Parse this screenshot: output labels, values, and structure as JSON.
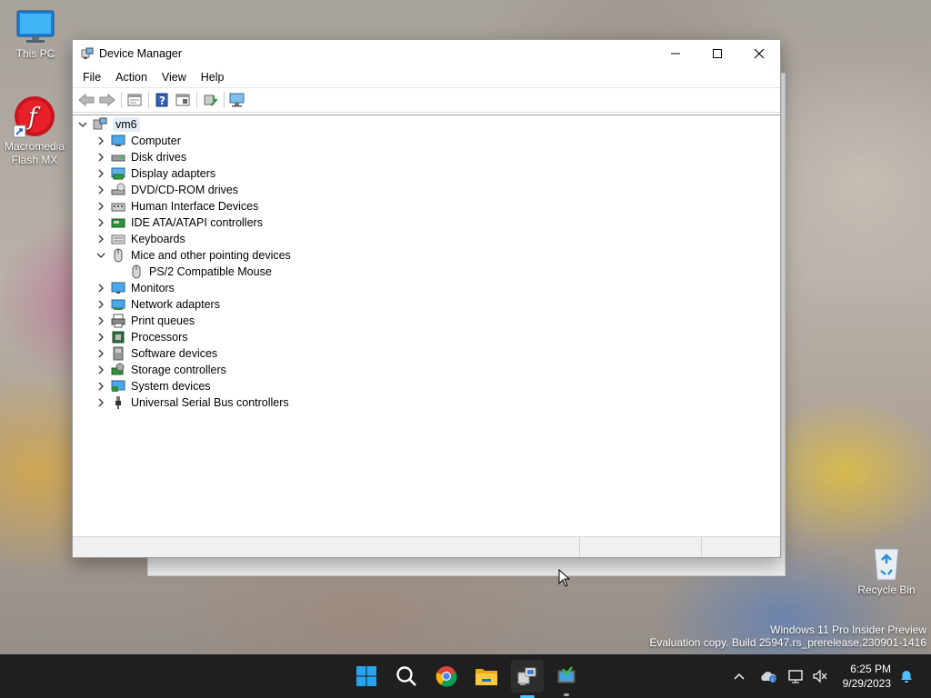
{
  "desktop": {
    "icons": [
      {
        "label": "This PC",
        "icon": "monitor-icon"
      },
      {
        "label": "Macromedia Flash MX",
        "icon": "flash-icon"
      },
      {
        "label": "Recycle Bin",
        "icon": "recycle-bin-icon"
      }
    ],
    "watermark": {
      "line1": "Windows 11 Pro Insider Preview",
      "line2": "Evaluation copy. Build 25947.rs_prerelease.230901-1416"
    }
  },
  "window": {
    "title": "Device Manager",
    "controls": {
      "minimize": "—",
      "maximize": "☐",
      "close": "✕"
    },
    "menu": [
      "File",
      "Action",
      "View",
      "Help"
    ],
    "toolbar": [
      "back",
      "forward",
      "properties",
      "help",
      "view",
      "update-driver",
      "scan-hardware"
    ],
    "tree": {
      "root": "vm6",
      "categories": [
        {
          "label": "Computer",
          "expanded": false,
          "icon": "computer-icon"
        },
        {
          "label": "Disk drives",
          "expanded": false,
          "icon": "disk-drive-icon"
        },
        {
          "label": "Display adapters",
          "expanded": false,
          "icon": "display-adapter-icon"
        },
        {
          "label": "DVD/CD-ROM drives",
          "expanded": false,
          "icon": "dvd-drive-icon"
        },
        {
          "label": "Human Interface Devices",
          "expanded": false,
          "icon": "hid-icon"
        },
        {
          "label": "IDE ATA/ATAPI controllers",
          "expanded": false,
          "icon": "ide-controller-icon"
        },
        {
          "label": "Keyboards",
          "expanded": false,
          "icon": "keyboard-icon"
        },
        {
          "label": "Mice and other pointing devices",
          "expanded": true,
          "icon": "mouse-icon",
          "children": [
            "PS/2 Compatible Mouse"
          ]
        },
        {
          "label": "Monitors",
          "expanded": false,
          "icon": "monitor-icon"
        },
        {
          "label": "Network adapters",
          "expanded": false,
          "icon": "network-adapter-icon"
        },
        {
          "label": "Print queues",
          "expanded": false,
          "icon": "printer-icon"
        },
        {
          "label": "Processors",
          "expanded": false,
          "icon": "processor-icon"
        },
        {
          "label": "Software devices",
          "expanded": false,
          "icon": "software-device-icon"
        },
        {
          "label": "Storage controllers",
          "expanded": false,
          "icon": "storage-controller-icon"
        },
        {
          "label": "System devices",
          "expanded": false,
          "icon": "system-devices-icon"
        },
        {
          "label": "Universal Serial Bus controllers",
          "expanded": false,
          "icon": "usb-icon"
        }
      ]
    }
  },
  "taskbar": {
    "apps": [
      "start-icon",
      "search-icon",
      "chrome-icon",
      "file-explorer-icon",
      "device-manager-icon",
      "app-icon"
    ],
    "tray": [
      "chevron-up-icon",
      "onedrive-icon",
      "network-icon",
      "volume-muted-icon",
      "notification-bell-icon"
    ],
    "time": "6:25 PM",
    "date": "9/29/2023"
  }
}
